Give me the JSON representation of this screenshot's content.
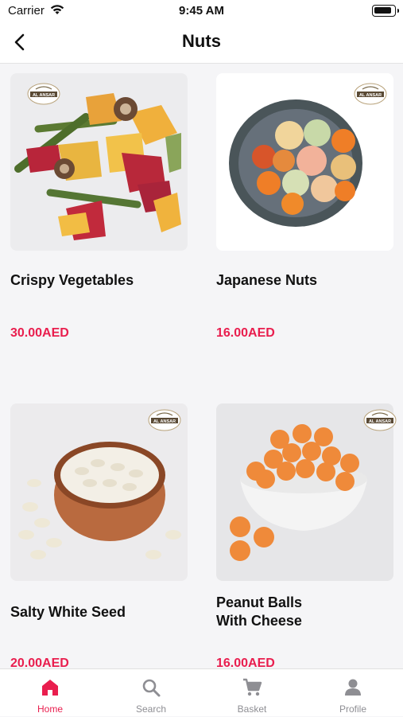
{
  "status_bar": {
    "carrier": "Carrier",
    "time": "9:45 AM"
  },
  "header": {
    "title": "Nuts",
    "back_icon": "chevron-left-icon"
  },
  "products": [
    {
      "name": "Crispy Vegetables",
      "price": "30.00AED",
      "image": "crispy-vegetables-photo",
      "brand": "AL ANSAR"
    },
    {
      "name": "Japanese Nuts",
      "price": "16.00AED",
      "image": "japanese-nuts-photo",
      "brand": "AL ANSAR"
    },
    {
      "name": "Salty White Seed",
      "price": "20.00AED",
      "image": "salty-white-seed-photo",
      "brand": "AL ANSAR"
    },
    {
      "name": "Peanut Balls\nWith Cheese",
      "price": "16.00AED",
      "image": "peanut-balls-photo",
      "brand": "AL ANSAR"
    }
  ],
  "tabbar": {
    "items": [
      {
        "label": "Home",
        "icon": "home-icon",
        "active": true
      },
      {
        "label": "Search",
        "icon": "search-icon",
        "active": false
      },
      {
        "label": "Basket",
        "icon": "cart-icon",
        "active": false
      },
      {
        "label": "Profile",
        "icon": "profile-icon",
        "active": false
      }
    ]
  },
  "colors": {
    "accent": "#e91e4e",
    "inactive": "#8e8e93",
    "background": "#f5f5f7"
  }
}
